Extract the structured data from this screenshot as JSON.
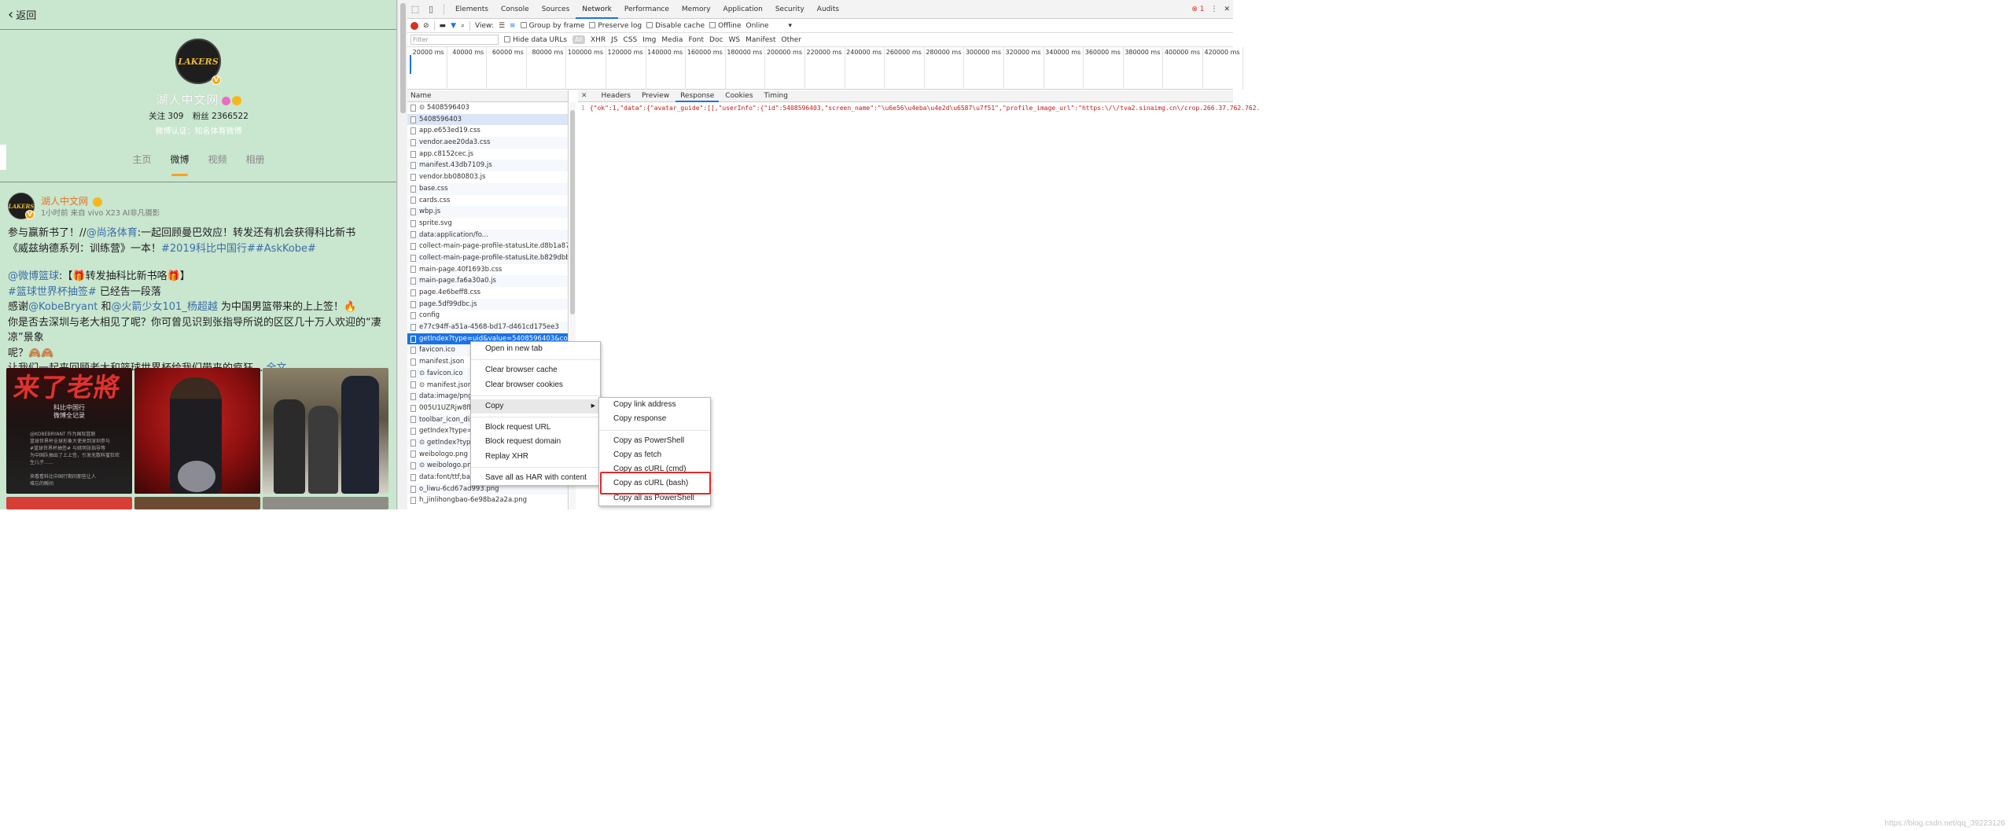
{
  "mobile": {
    "back_label": "返回",
    "avatar_text": "LAKERS",
    "v_badge": "V",
    "profile_name": "湖人中文网",
    "following_label": "关注 309",
    "followers_label": "粉丝 2366522",
    "verify_text": "微博认证：知名体育微博",
    "tabs": [
      "主页",
      "微博",
      "视频",
      "相册"
    ],
    "active_tab": "微博",
    "post": {
      "author": "湖人中文网",
      "meta": "1小时前 来自 vivo X23 AI非凡摄影",
      "line1a": "参与赢新书了！//",
      "line1_link": "@尚洛体育",
      "line1b": ":一起回顾曼巴效应！转发还有机会获得科比新书",
      "line2a": "《威兹纳德系列：训练营》一本！",
      "line2_link": "#2019科比中国行##AskKobe#",
      "line3_link": "@微博篮球",
      "line3b": ":【🎁转发抽科比新书咯🎁】",
      "line4_link": "#篮球世界杯抽签#",
      "line4b": " 已经告一段落",
      "line5a": "感谢",
      "line5_link1": "@KobeBryant",
      "line5b": " 和",
      "line5_link2": "@火箭少女101_杨超越",
      "line5c": " 为中国男篮带来的上上签！🔥",
      "line6": "你是否去深圳与老大相见了呢？你可曾见识到张指导所说的区区几十万人欢迎的“凄凉”景象",
      "line7": "呢？🙈🙈",
      "line8a": "让我们一起来回顾老大和篮球世界杯给我们带来的疯狂 ...",
      "line8_link": "全文"
    },
    "image1": {
      "title": "来了老將",
      "subtitle": "科比中国行\n微博全记录",
      "body": "@KOBEBRYANT 作为国际篮联\n篮球世界杯全球形象大使来到深圳参与\n#篮球世界杯抽签# 与姚明张指导等\n为中国队抽出了上上签，引发无数科蜜狂欢\n生儿子……\n\n来看看科比中国行期间那些让人\n难忘的瞬间"
    }
  },
  "devtools": {
    "tabs": [
      "Elements",
      "Console",
      "Sources",
      "Network",
      "Performance",
      "Memory",
      "Application",
      "Security",
      "Audits"
    ],
    "active_tab": "Network",
    "error_count": "1",
    "toolbar": {
      "view_label": "View:",
      "group_by_frame": "Group by frame",
      "preserve_log": "Preserve log",
      "disable_cache": "Disable cache",
      "offline": "Offline",
      "throttle": "Online"
    },
    "filter": {
      "placeholder": "Filter",
      "hide_data_urls": "Hide data URLs",
      "types": [
        "All",
        "XHR",
        "JS",
        "CSS",
        "Img",
        "Media",
        "Font",
        "Doc",
        "WS",
        "Manifest",
        "Other"
      ]
    },
    "timeline_ticks": [
      "20000 ms",
      "40000 ms",
      "60000 ms",
      "80000 ms",
      "100000 ms",
      "120000 ms",
      "140000 ms",
      "160000 ms",
      "180000 ms",
      "200000 ms",
      "220000 ms",
      "240000 ms",
      "260000 ms",
      "280000 ms",
      "300000 ms",
      "320000 ms",
      "340000 ms",
      "360000 ms",
      "380000 ms",
      "400000 ms",
      "420000 ms"
    ],
    "list_header": "Name",
    "requests": [
      "⊙ 5408596403",
      "5408596403",
      "app.e653ed19.css",
      "vendor.aee20da3.css",
      "app.c8152cec.js",
      "manifest.43db7109.js",
      "vendor.bb080803.js",
      "base.css",
      "cards.css",
      "wbp.js",
      "sprite.svg",
      "data:application/fo...",
      "collect-main-page-profile-statusLite.d8b1a870.css",
      "collect-main-page-profile-statusLite.b829dbbd.js",
      "main-page.40f1693b.css",
      "main-page.fa6a30a0.js",
      "page.4e6beff8.css",
      "page.5df99dbc.js",
      "config",
      "e77c94ff-a51a-4568-bd17-d461cd175ee3",
      "getIndex?type=uid&value=5408596403&containe",
      "favicon.ico",
      "manifest.json",
      "⊙ favicon.ico",
      "⊙ manifest.json",
      "data:image/png;ba",
      "005U1UZRjw8fbl",
      "toolbar_icon_disc",
      "getIndex?type=u",
      "⊙ getIndex?type",
      "weibologo.png",
      "⊙ weibologo.png",
      "data:font/ttf;base",
      "o_liwu-6cd67ad993.png",
      "h_jinlihongbao-6e98ba2a2a.png"
    ],
    "selected_request_index": 20,
    "detail_tabs": [
      "Headers",
      "Preview",
      "Response",
      "Cookies",
      "Timing"
    ],
    "active_detail_tab": "Response",
    "response_line_no": "1",
    "response_text": "{\"ok\":1,\"data\":{\"avatar_guide\":[],\"userInfo\":{\"id\":5408596403,\"screen_name\":\"\\u6e56\\u4eba\\u4e2d\\u6587\\u7f51\",\"profile_image_url\":\"https:\\/\\/tva2.sinaimg.cn\\/crop.266.37.762.762.",
    "context_menu": {
      "items": [
        "Open in new tab",
        "Clear browser cache",
        "Clear browser cookies",
        "Copy",
        "Block request URL",
        "Block request domain",
        "Replay XHR",
        "Save all as HAR with content"
      ],
      "highlighted": "Copy"
    },
    "copy_submenu": {
      "items": [
        "Copy link address",
        "Copy response",
        "Copy as PowerShell",
        "Copy as fetch",
        "Copy as cURL (cmd)",
        "Copy as cURL (bash)",
        "Copy all as PowerShell"
      ],
      "highlighted": "Copy as cURL (bash)"
    }
  },
  "watermark": "https://blog.csdn.net/qq_39223126",
  "colors": {
    "mobile_bg": "#c9e6cf",
    "accent_orange": "#f8a21c",
    "link_blue": "#3c6ea8",
    "devtools_blue": "#1a73e8",
    "highlight_red": "#e22828"
  }
}
